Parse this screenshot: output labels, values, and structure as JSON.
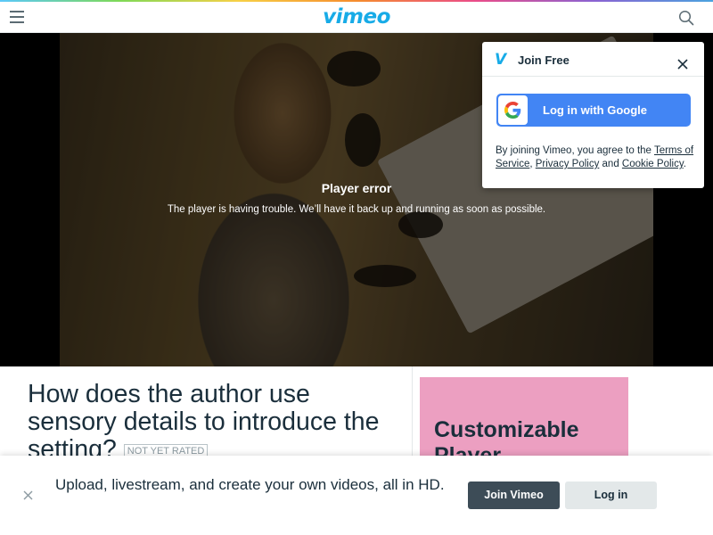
{
  "header": {
    "logo": "vimeo",
    "menu_icon": "hamburger-menu-icon",
    "search_icon": "search-icon",
    "brand_color": "#17abe7"
  },
  "player": {
    "error_title": "Player error",
    "error_message": "The player is having trouble. We’ll have it back up and running as soon as possible."
  },
  "join_popup": {
    "title": "Join Free",
    "google_button": "Log in with Google",
    "terms_prefix": "By joining Vimeo, you agree to the ",
    "terms_link": "Terms of Service",
    "sep1": ", ",
    "privacy_link": "Privacy Policy",
    "sep2": " and ",
    "cookie_link": "Cookie Policy",
    "suffix": "."
  },
  "video": {
    "title": "How does the author use sensory details to introduce the setting?",
    "rating": "NOT YET RATED"
  },
  "ad": {
    "text": "Customizable Player",
    "color": "#ec9fc1"
  },
  "banner": {
    "text": "Upload, livestream, and create your own videos, all in HD.",
    "join_button": "Join Vimeo",
    "login_button": "Log in"
  }
}
